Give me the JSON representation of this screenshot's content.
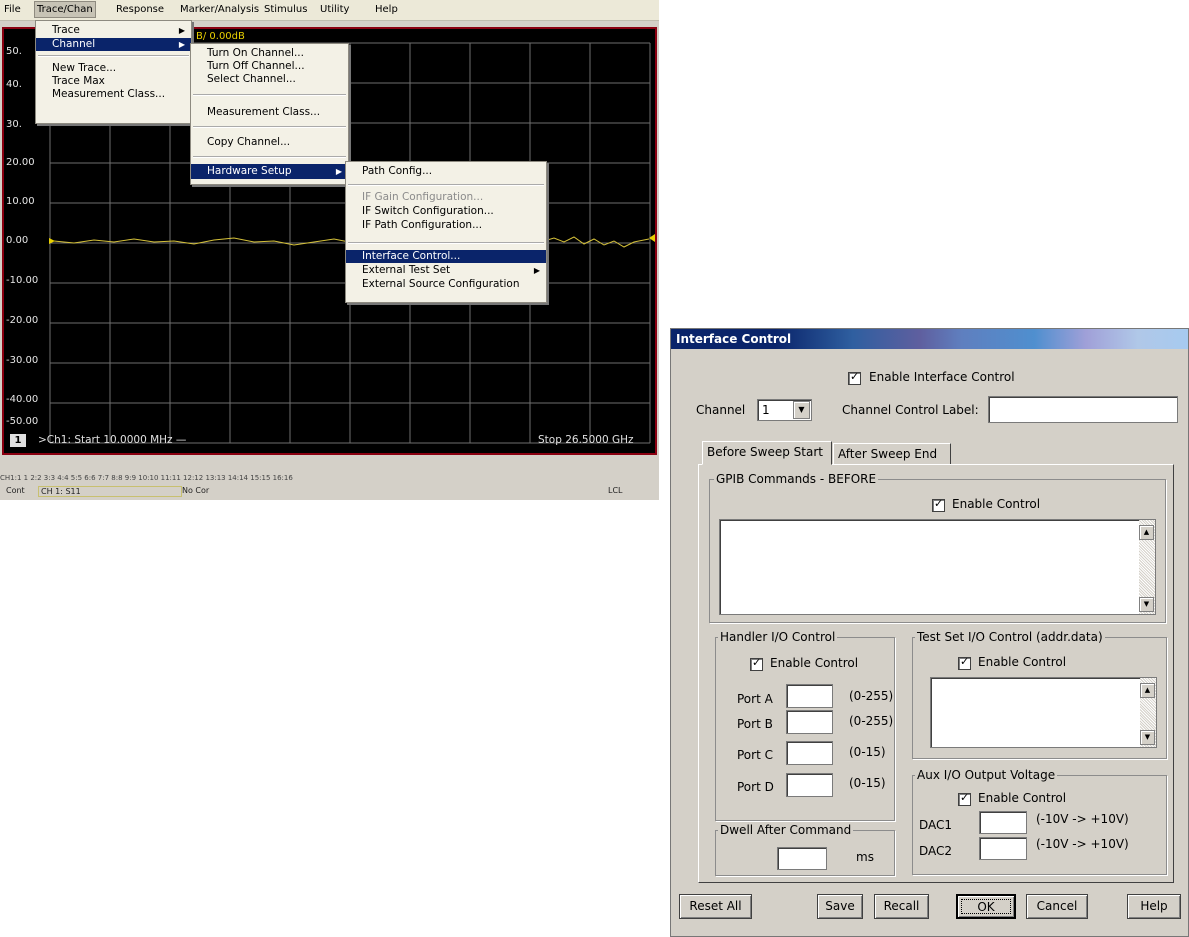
{
  "vna": {
    "menubar": [
      "File",
      "Trace/Chan",
      "Response",
      "Marker/Analysis",
      "Stimulus",
      "Utility",
      "Help"
    ],
    "trace_label": "B/ 0.00dB",
    "y_axis_labels": [
      "50.",
      "40.",
      "30.",
      "20.00",
      "10.00",
      "0.00",
      "-10.00",
      "-20.00",
      "-30.00",
      "-40.00",
      "-50.00"
    ],
    "channel_number": "1",
    "start_text": ">Ch1: Start  10.0000 MHz —",
    "stop_text": "Stop  26.5000 GHz",
    "channel_strip": "CH1:1  1  2:2  3:3  4:4  5:5  6:6  7:7  8:8  9:9  10:10  11:11  12:12  13:13  14:14  15:15  16:16",
    "status": {
      "mode": "Cont",
      "channel_param": "CH 1:  S11",
      "correction": "No Cor",
      "remote": "LCL"
    },
    "menu_trace_chan": {
      "items": [
        "Trace",
        "Channel",
        "New Trace...",
        "Trace Max",
        "Measurement Class..."
      ]
    },
    "menu_channel": {
      "items": [
        "Turn On Channel...",
        "Turn Off Channel...",
        "Select Channel...",
        "Measurement Class...",
        "Copy Channel...",
        "Hardware Setup"
      ]
    },
    "menu_hardware": {
      "items": [
        "Path Config...",
        "IF Gain Configuration...",
        "IF Switch Configuration...",
        "IF Path Configuration...",
        "Interface Control...",
        "External Test Set",
        "External Source Configuration"
      ]
    }
  },
  "dialog": {
    "title": "Interface Control",
    "enable_interface": "Enable Interface Control",
    "channel_label": "Channel",
    "channel_value": "1",
    "channel_control_label": "Channel Control Label:",
    "tabs": [
      "Before Sweep Start",
      "After Sweep End"
    ],
    "gpib_group": "GPIB Commands - BEFORE",
    "enable_control": "Enable Control",
    "handler_group": "Handler I/O Control",
    "ports": [
      {
        "label": "Port A",
        "range": "(0-255)"
      },
      {
        "label": "Port B",
        "range": "(0-255)"
      },
      {
        "label": "Port C",
        "range": "(0-15)"
      },
      {
        "label": "Port D",
        "range": "(0-15)"
      }
    ],
    "testset_group": "Test Set I/O Control (addr.data)",
    "aux_group": "Aux I/O Output Voltage",
    "dacs": [
      {
        "label": "DAC1",
        "range": "(-10V -> +10V)"
      },
      {
        "label": "DAC2",
        "range": "(-10V -> +10V)"
      }
    ],
    "dwell_group": "Dwell After Command",
    "dwell_unit": "ms",
    "buttons": {
      "reset": "Reset All",
      "save": "Save",
      "recall": "Recall",
      "ok": "OK",
      "cancel": "Cancel",
      "help": "Help"
    }
  }
}
